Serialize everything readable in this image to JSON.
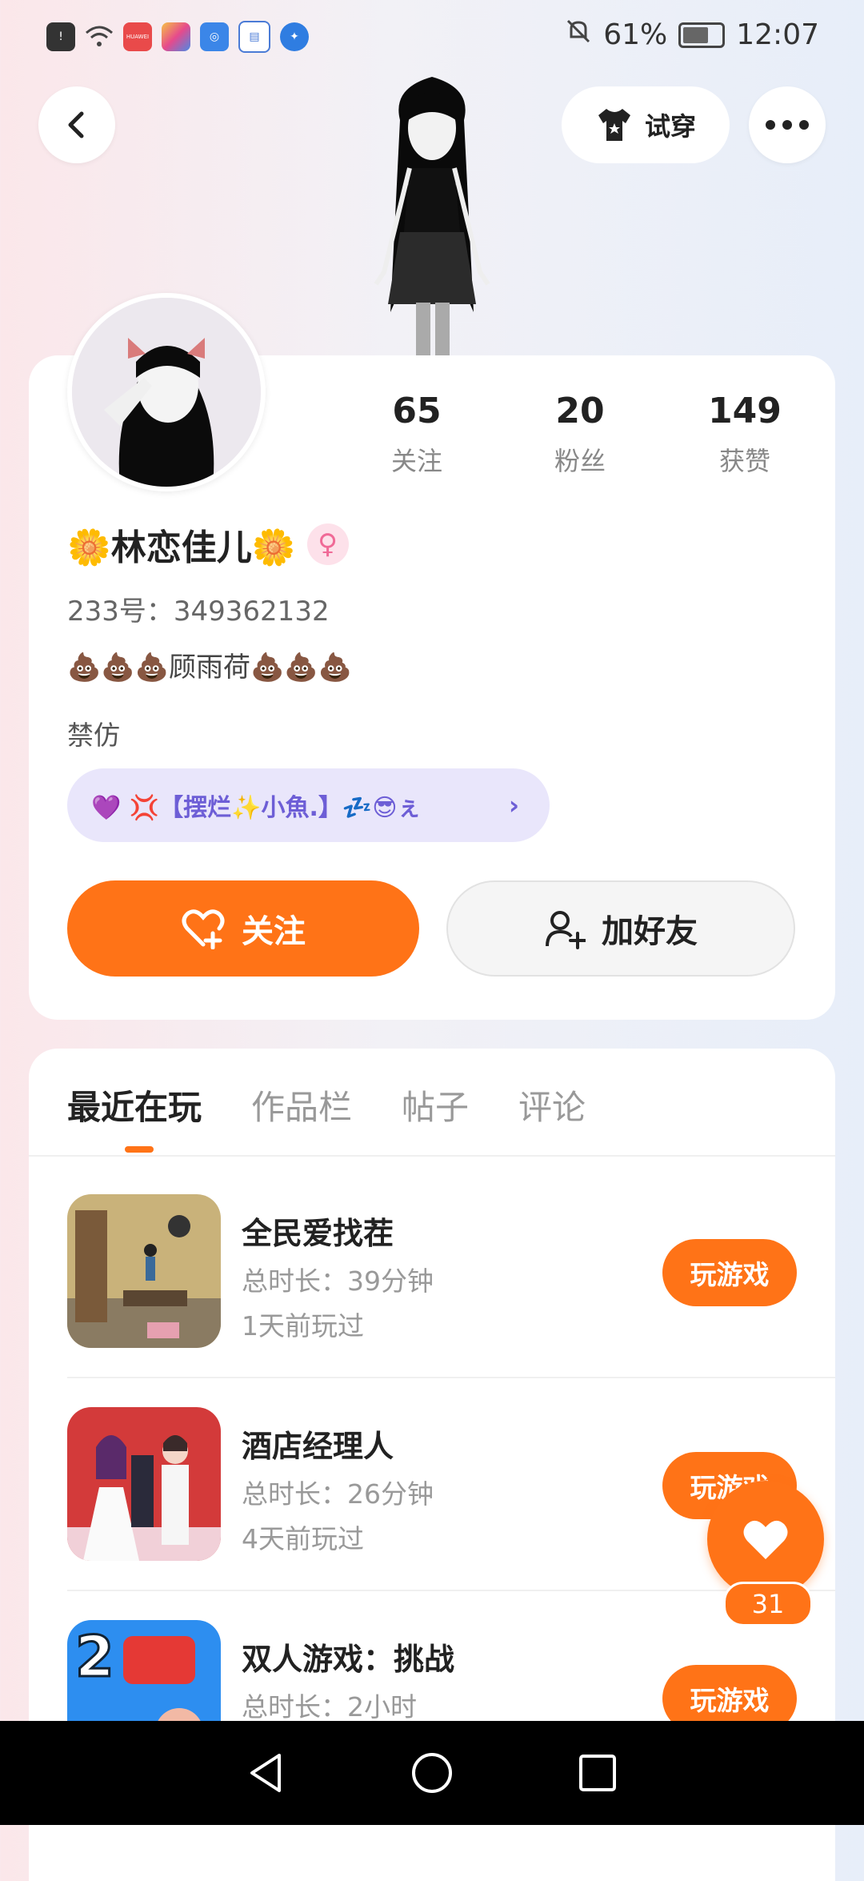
{
  "status_bar": {
    "battery": "61%",
    "time": "12:07",
    "icons": [
      "alert-icon",
      "wifi-icon",
      "huawei-app-icon",
      "appstore-icon",
      "qq-icon",
      "calendar-icon",
      "browser-icon",
      "mute-icon",
      "battery-icon"
    ],
    "huawei_label": "HUAWEI"
  },
  "header": {
    "try_on_label": "试穿"
  },
  "profile": {
    "nickname": "🌼林恋佳儿🌼",
    "gender_symbol": "♀",
    "uid": "233号：349362132",
    "bio": "💩💩💩顾雨荷💩💩💩",
    "bio2": "禁仿",
    "club": "💜 💢【摆烂✨小魚.】💤😎ぇ",
    "stats": [
      {
        "value": "65",
        "label": "关注"
      },
      {
        "value": "20",
        "label": "粉丝"
      },
      {
        "value": "149",
        "label": "获赞"
      }
    ],
    "follow_label": "关注",
    "add_friend_label": "加好友"
  },
  "tabs": [
    {
      "label": "最近在玩",
      "active": true
    },
    {
      "label": "作品栏",
      "active": false
    },
    {
      "label": "帖子",
      "active": false
    },
    {
      "label": "评论",
      "active": false
    }
  ],
  "games": [
    {
      "name": "全民爱找茬",
      "duration": "总时长：39分钟",
      "last_played": "1天前玩过",
      "button": "玩游戏"
    },
    {
      "name": "酒店经理人",
      "duration": "总时长：26分钟",
      "last_played": "4天前玩过",
      "button": "玩游戏"
    },
    {
      "name": "双人游戏：挑战",
      "duration": "总时长：2小时",
      "last_played": "",
      "button": "玩游戏"
    }
  ],
  "like_fab": {
    "count": "31"
  },
  "colors": {
    "accent": "#ff7317",
    "club_bg": "#e9e6fb",
    "club_text": "#6d5ed6"
  }
}
